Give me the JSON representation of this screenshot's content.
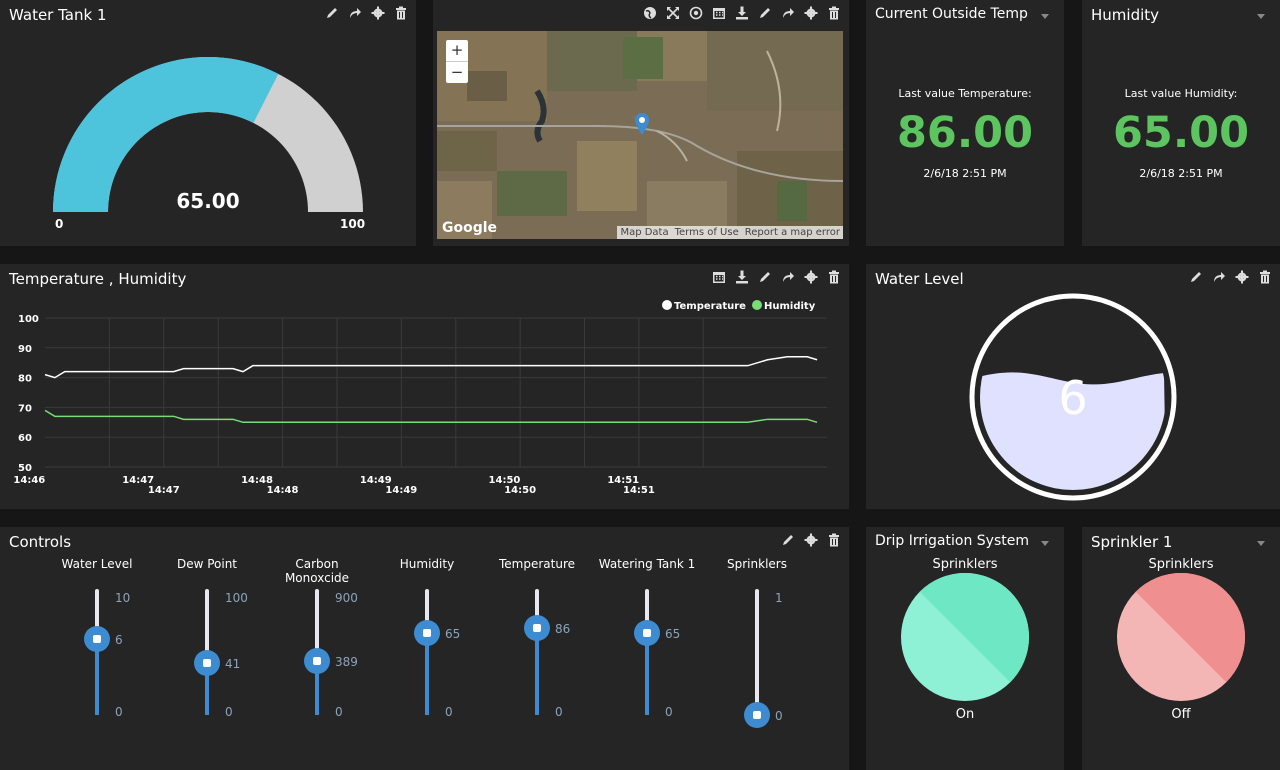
{
  "panels": {
    "tank": {
      "title": "Water Tank 1",
      "value": "65.00",
      "min": "0",
      "max": "100",
      "fill": 0.65
    },
    "map": {
      "google": "Google",
      "map_data": "Map Data",
      "terms": "Terms of Use",
      "report": "Report a map error",
      "zoom_in": "+",
      "zoom_out": "−"
    },
    "temp": {
      "title": "Current Outside Temp",
      "label": "Last value Temperature:",
      "value": "86.00",
      "time": "2/6/18 2:51 PM"
    },
    "humidity": {
      "title": "Humidity",
      "label": "Last value Humidity:",
      "value": "65.00",
      "time": "2/6/18 2:51 PM"
    },
    "chart": {
      "title": "Temperature , Humidity"
    },
    "water_level": {
      "title": "Water Level",
      "value": "6",
      "fill": 0.6
    },
    "controls": {
      "title": "Controls"
    },
    "drip": {
      "title": "Drip Irrigation System",
      "label": "Sprinklers",
      "state": "On"
    },
    "sprinkler": {
      "title": "Sprinkler 1",
      "label": "Sprinklers",
      "state": "Off"
    }
  },
  "sliders": [
    {
      "label": "Water Level",
      "max": "10",
      "value": "6",
      "min": "0",
      "level": 0.6
    },
    {
      "label": "Dew Point",
      "max": "100",
      "value": "41",
      "min": "0",
      "level": 0.41
    },
    {
      "label": "Carbon Monoxcide",
      "max": "900",
      "value": "389",
      "min": "0",
      "level": 0.432
    },
    {
      "label": "Humidity",
      "max": "",
      "value": "65",
      "min": "0",
      "level": 0.65
    },
    {
      "label": "Temperature",
      "max": "",
      "value": "86",
      "min": "0",
      "level": 0.69
    },
    {
      "label": "Watering Tank 1",
      "max": "",
      "value": "65",
      "min": "0",
      "level": 0.65
    },
    {
      "label": "Sprinklers",
      "max": "1",
      "value": "0",
      "min": "",
      "level": 0.0
    }
  ],
  "chart_data": {
    "type": "line",
    "title": "",
    "xlabel": "",
    "ylabel": "",
    "ylim": [
      50,
      100
    ],
    "yticks": [
      "100",
      "90",
      "80",
      "70",
      "60",
      "50"
    ],
    "xticks_top": [
      "14:46",
      "14:47",
      "14:48",
      "14:49",
      "14:50",
      "14:51"
    ],
    "xticks_bottom": [
      "14:47",
      "14:48",
      "14:49",
      "14:50",
      "14:51"
    ],
    "grid": true,
    "legend_position": "top-right",
    "x_minutes": [
      0,
      0.1,
      0.2,
      1.3,
      1.4,
      1.9,
      2.0,
      2.1,
      7.1,
      7.3,
      7.5,
      7.7,
      7.8
    ],
    "series": [
      {
        "name": "Temperature",
        "color": "#ffffff",
        "values": [
          81,
          80,
          82,
          82,
          83,
          83,
          82,
          84,
          84,
          86,
          87,
          87,
          86
        ]
      },
      {
        "name": "Humidity",
        "color": "#77dd77",
        "values": [
          69,
          67,
          67,
          67,
          66,
          66,
          65,
          65,
          65,
          66,
          66,
          66,
          65
        ]
      }
    ]
  },
  "colors": {
    "gauge_fill": "#4ec3dc",
    "gauge_rest": "#d0d0d0",
    "value_green": "#5cc55f",
    "slider_blue": "#3d8bd1",
    "switch_on": "#6ee8c4",
    "switch_off": "#ef8f8f",
    "water": "#e0e0ff"
  },
  "icons": [
    "pencil-icon",
    "share-icon",
    "gear-icon",
    "trash-icon",
    "globe-icon",
    "expand-icon",
    "target-icon",
    "calendar-icon",
    "download-icon",
    "map-pin-icon",
    "dropdown-caret-icon"
  ]
}
